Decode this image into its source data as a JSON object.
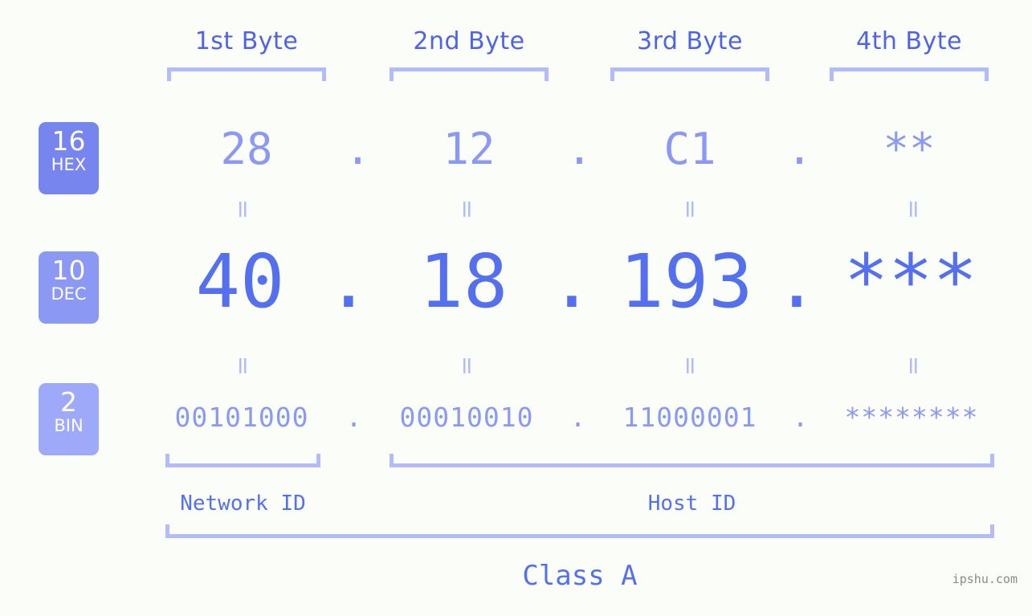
{
  "meta": {
    "watermark": "ipshu.com",
    "background_color": "#fbfdf8",
    "accent_strong": "#5470ee",
    "accent_mid": "#8b98f4",
    "accent_light": "#b3bcfb"
  },
  "byte_headers": [
    {
      "label": "1st Byte"
    },
    {
      "label": "2nd Byte"
    },
    {
      "label": "3rd Byte"
    },
    {
      "label": "4th Byte"
    }
  ],
  "bases": [
    {
      "number": "16",
      "name": "HEX",
      "color": "#7785ef"
    },
    {
      "number": "10",
      "name": "DEC",
      "color": "#8b98f4"
    },
    {
      "number": "2",
      "name": "BIN",
      "color": "#9eaaf9"
    }
  ],
  "separator": ".",
  "equals_mark": "=",
  "rows": {
    "hex": {
      "base": "16",
      "values": [
        "28",
        "12",
        "C1",
        "**"
      ]
    },
    "dec": {
      "base": "10",
      "values": [
        "40",
        "18",
        "193",
        "***"
      ]
    },
    "bin": {
      "base": "2",
      "values": [
        "00101000",
        "00010010",
        "11000001",
        "********"
      ]
    }
  },
  "sections": {
    "network_id": "Network ID",
    "host_id": "Host ID",
    "class": "Class A"
  }
}
